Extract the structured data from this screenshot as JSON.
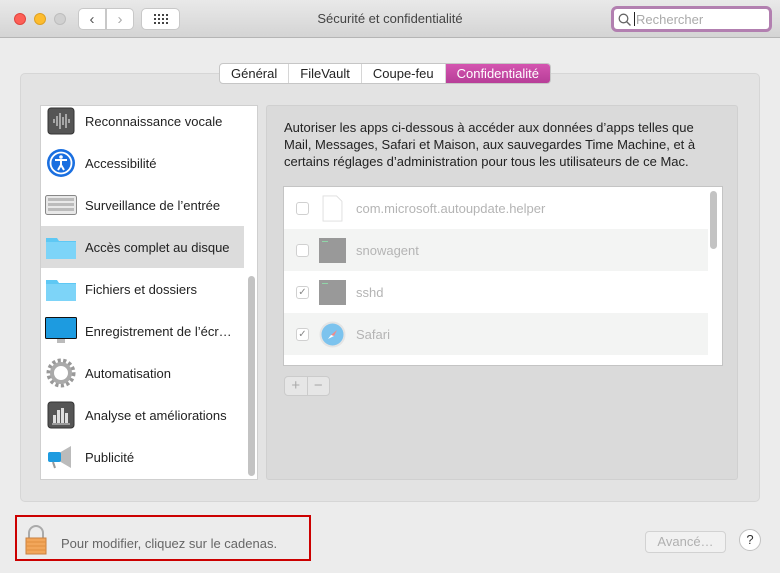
{
  "window": {
    "title": "Sécurité et confidentialité",
    "search_placeholder": "Rechercher"
  },
  "tabs": [
    {
      "label": "Général"
    },
    {
      "label": "FileVault"
    },
    {
      "label": "Coupe-feu"
    },
    {
      "label": "Confidentialité",
      "active": true
    }
  ],
  "sidebar": {
    "items": [
      {
        "label": "Reconnaissance vocale",
        "icon": "waveform-icon"
      },
      {
        "label": "Accessibilité",
        "icon": "accessibility-icon"
      },
      {
        "label": "Surveillance de l’entrée",
        "icon": "keyboard-icon"
      },
      {
        "label": "Accès complet au disque",
        "icon": "folder-icon",
        "selected": true
      },
      {
        "label": "Fichiers et dossiers",
        "icon": "folder-icon"
      },
      {
        "label": "Enregistrement de l’écr…",
        "icon": "display-icon"
      },
      {
        "label": "Automatisation",
        "icon": "gear-icon"
      },
      {
        "label": "Analyse et améliorations",
        "icon": "bar-chart-icon"
      },
      {
        "label": "Publicité",
        "icon": "megaphone-icon"
      }
    ]
  },
  "main": {
    "description": "Autoriser les apps ci-dessous à accéder aux données d’apps telles que Mail, Messages, Safari et Maison, aux sauvegardes Time Machine, et à certains réglages d’administration pour tous les utilisateurs de ce Mac.",
    "apps": [
      {
        "name": "com.microsoft.autoupdate.helper",
        "checked": false,
        "icon": "document-icon"
      },
      {
        "name": "snowagent",
        "checked": false,
        "icon": "terminal-icon"
      },
      {
        "name": "sshd",
        "checked": true,
        "icon": "terminal-icon"
      },
      {
        "name": "Safari",
        "checked": true,
        "icon": "safari-icon"
      }
    ],
    "add_label": "+",
    "remove_label": "−"
  },
  "footer": {
    "lock_text": "Pour modifier, cliquez sur le cadenas.",
    "advanced_label": "Avancé…",
    "help_label": "?"
  }
}
